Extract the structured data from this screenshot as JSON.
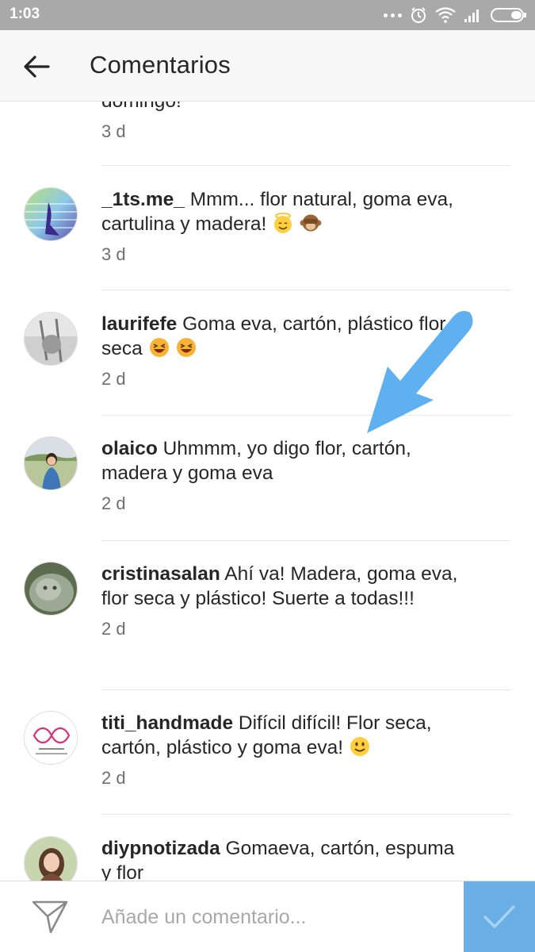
{
  "status_bar": {
    "time": "1:03"
  },
  "header": {
    "title": "Comentarios",
    "back_icon": "arrow-left-icon"
  },
  "comments": [
    {
      "username": "",
      "text": "domingo!",
      "time": "3 d",
      "avatar_icon": "none"
    },
    {
      "username": "_1ts.me_",
      "text": "Mmm... flor natural, goma eva, cartulina y madera!",
      "emojis": [
        "smiling-face-with-halo",
        "see-no-evil-monkey"
      ],
      "time": "3 d"
    },
    {
      "username": "laurifefe",
      "text": "Goma eva, cartón, plástico flor seca",
      "emojis": [
        "grinning-squinting-face",
        "grinning-squinting-face"
      ],
      "time": "2 d"
    },
    {
      "username": "olaico",
      "text": "Uhmmm, yo digo flor, cartón, madera y goma eva",
      "time": "2 d"
    },
    {
      "username": "cristinasalan",
      "text": "Ahí va! Madera, goma eva, flor seca y plástico! Suerte a todas!!!",
      "time": "2 d"
    },
    {
      "username": "titi_handmade",
      "text": "Difícil difícil! Flor seca, cartón, plástico y goma eva!",
      "emojis": [
        "slightly-smiling-face"
      ],
      "time": "2 d"
    },
    {
      "username": "diypnotizada",
      "text": "Gomaeva, cartón, espuma y flor",
      "time": ""
    }
  ],
  "comment_bar": {
    "placeholder": "Añade un comentario...",
    "send_icon": "send-paper-plane-icon",
    "post_icon": "checkmark-icon"
  },
  "colors": {
    "status_bar": "#a9a9a9",
    "header_bg": "#f7f7f7",
    "post_button": "#6aaee6",
    "annotation_arrow": "#5fb0f0",
    "time_text": "#6e6e6e"
  }
}
